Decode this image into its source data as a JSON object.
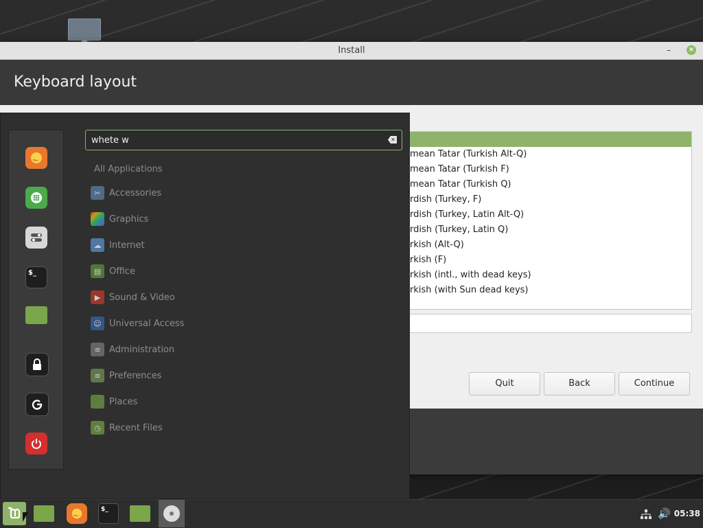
{
  "window": {
    "title": "Install",
    "minimize_symbol": "–",
    "close_symbol": "×",
    "page_title": "Keyboard layout"
  },
  "layouts": [
    "mean Tatar (Turkish Alt-Q)",
    "mean Tatar (Turkish F)",
    "mean Tatar (Turkish Q)",
    "rdish (Turkey, F)",
    "rdish (Turkey, Latin Alt-Q)",
    "rdish (Turkey, Latin Q)",
    "rkish (Alt-Q)",
    "rkish (F)",
    "rkish (intl., with dead keys)",
    "rkish (with Sun dead keys)"
  ],
  "buttons": {
    "quit": "Quit",
    "back": "Back",
    "continue": "Continue"
  },
  "menu": {
    "search_value": "whete w",
    "all_applications": "All Applications",
    "categories": [
      {
        "label": "Accessories",
        "icon": "scissors-icon",
        "color": "#5c7fa6"
      },
      {
        "label": "Graphics",
        "icon": "palette-icon",
        "color": "#9b59b6"
      },
      {
        "label": "Internet",
        "icon": "cloud-icon",
        "color": "#5b8fc7"
      },
      {
        "label": "Office",
        "icon": "document-icon",
        "color": "#5a8f3c"
      },
      {
        "label": "Sound & Video",
        "icon": "play-icon",
        "color": "#c0392b"
      },
      {
        "label": "Universal Access",
        "icon": "accessibility-icon",
        "color": "#3465a4"
      },
      {
        "label": "Administration",
        "icon": "toggle-icon",
        "color": "#777777"
      },
      {
        "label": "Preferences",
        "icon": "toggle-icon",
        "color": "#6f8f55"
      },
      {
        "label": "Places",
        "icon": "folder-icon",
        "color": "#6f9a45"
      },
      {
        "label": "Recent Files",
        "icon": "folder-clock-icon",
        "color": "#6f9a45"
      }
    ],
    "favorites": [
      {
        "name": "firefox",
        "color": "#e8782e"
      },
      {
        "name": "software-manager",
        "color": "#4caa4a"
      },
      {
        "name": "system-settings",
        "color": "#d8d8d8"
      },
      {
        "name": "terminal",
        "color": "#1e1e1e"
      },
      {
        "name": "files",
        "color": "#7aa64c"
      },
      {
        "name": "lock-screen",
        "color": "#1e1e1e"
      },
      {
        "name": "logout",
        "color": "#1e1e1e"
      },
      {
        "name": "power",
        "color": "#d32f2f"
      }
    ]
  },
  "taskbar": {
    "clock": "05:38",
    "terminal_glyph": "$_"
  },
  "colors": {
    "accent": "#8fb36a"
  }
}
